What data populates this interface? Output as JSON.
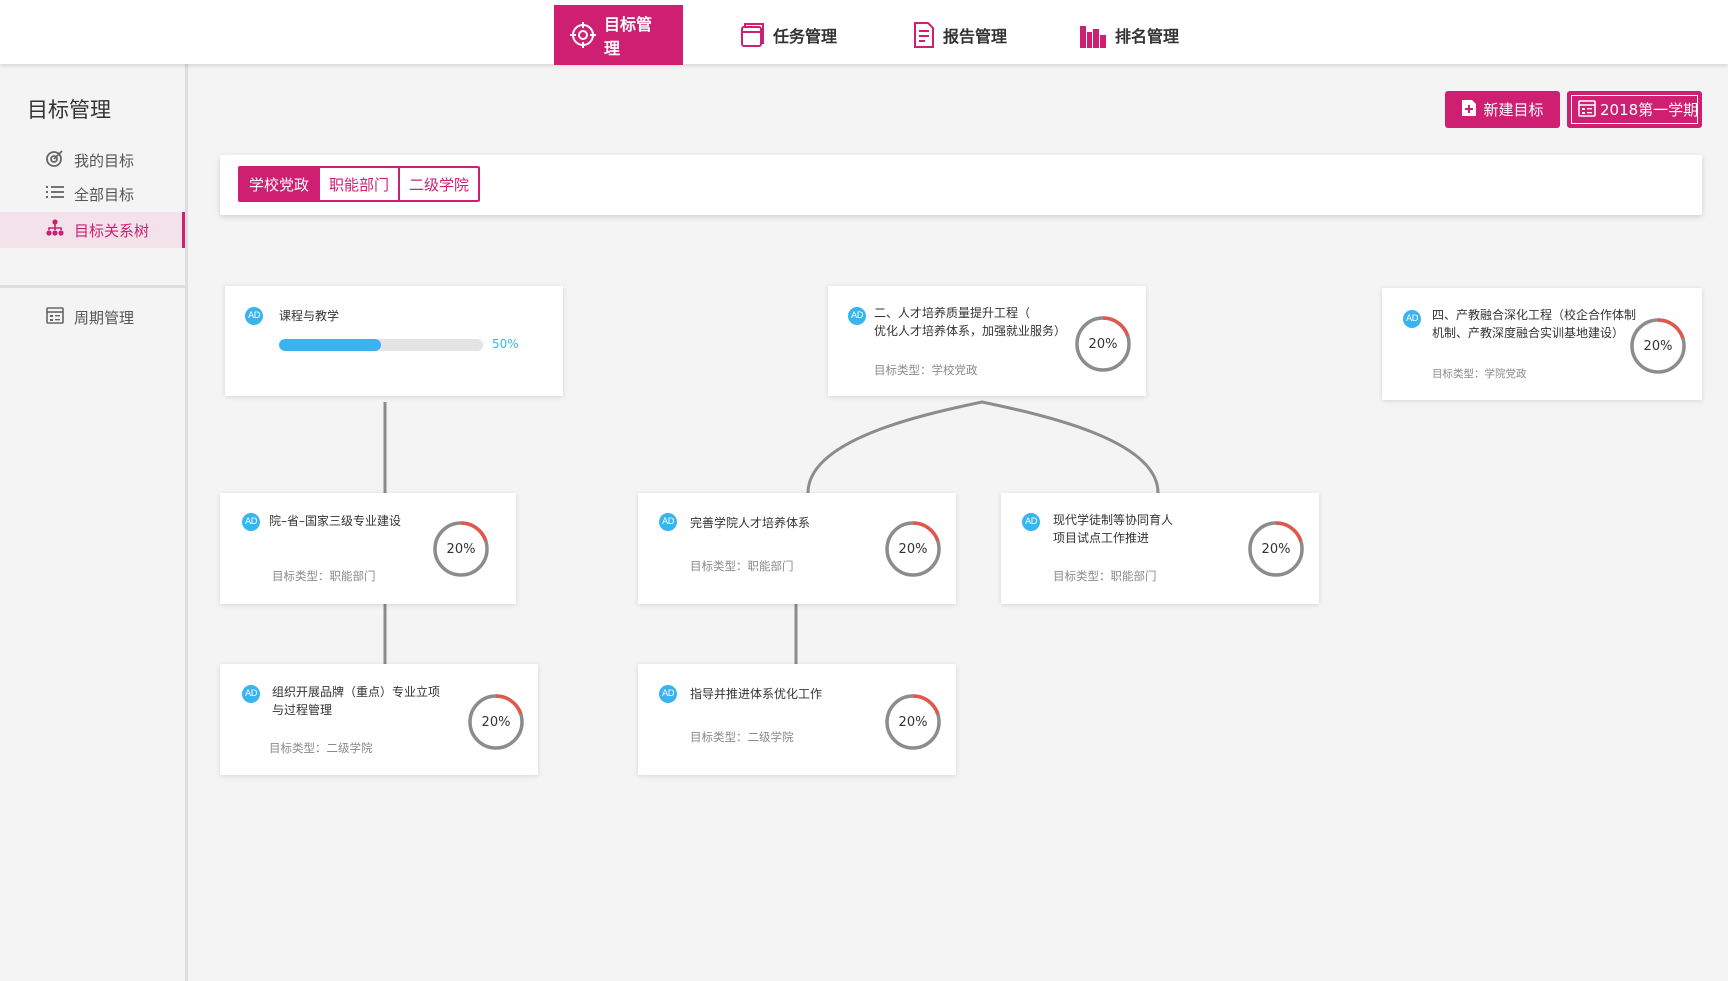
{
  "nav": {
    "items": [
      {
        "label": "目标管理",
        "icon": "target-icon",
        "active": true
      },
      {
        "label": "任务管理",
        "icon": "tasks-icon",
        "active": false
      },
      {
        "label": "报告管理",
        "icon": "report-icon",
        "active": false
      },
      {
        "label": "排名管理",
        "icon": "ranking-icon",
        "active": false
      }
    ]
  },
  "sidebar": {
    "title": "目标管理",
    "items": [
      {
        "label": "我的目标",
        "icon": "target-dart-icon"
      },
      {
        "label": "全部目标",
        "icon": "list-icon"
      },
      {
        "label": "目标关系树",
        "icon": "tree-icon",
        "active": true
      },
      {
        "label": "周期管理",
        "icon": "calendar-icon"
      }
    ]
  },
  "actions": {
    "new_goal": "新建目标",
    "term": "2018第一学期"
  },
  "filter": {
    "tabs": [
      {
        "label": "学校党政",
        "active": true
      },
      {
        "label": "职能部门",
        "active": false
      },
      {
        "label": "二级学院",
        "active": false
      }
    ]
  },
  "colors": {
    "accent": "#cf1f72",
    "progress": "#39b3f1",
    "badge": "#3ab4ee",
    "ring_track": "#8c8c8c",
    "ring_progress": "#e2574c"
  },
  "cards": [
    {
      "badge": "AD",
      "title_lines": [
        "课程与教学"
      ],
      "progress_label": "50%",
      "progress": 0.5
    },
    {
      "badge": "AD",
      "title_lines": [
        "二、人才培养质量提升工程（",
        "优化人才培养体系，加强就业服务）"
      ],
      "type_label": "目标类型：学校党政",
      "percent_label": "20%",
      "percent": 0.2
    },
    {
      "badge": "AD",
      "title_lines": [
        "四、产教融合深化工程（校企合作体制",
        "机制、产教深度融合实训基地建设）"
      ],
      "type_label": "目标类型：学院党政",
      "percent_label": "20%",
      "percent": 0.2
    },
    {
      "badge": "AD",
      "title_lines": [
        "院–省–国家三级专业建设"
      ],
      "type_label": "目标类型：职能部门",
      "percent_label": "20%",
      "percent": 0.2
    },
    {
      "badge": "AD",
      "title_lines": [
        "完善学院人才培养体系"
      ],
      "type_label": "目标类型：职能部门",
      "percent_label": "20%",
      "percent": 0.2
    },
    {
      "badge": "AD",
      "title_lines": [
        "现代学徒制等协同育人",
        "项目试点工作推进"
      ],
      "type_label": "目标类型：职能部门",
      "percent_label": "20%",
      "percent": 0.2
    },
    {
      "badge": "AD",
      "title_lines": [
        "组织开展品牌（重点）专业立项",
        "与过程管理"
      ],
      "type_label": "目标类型：二级学院",
      "percent_label": "20%",
      "percent": 0.2
    },
    {
      "badge": "AD",
      "title_lines": [
        "指导并推进体系优化工作"
      ],
      "type_label": "目标类型：二级学院",
      "percent_label": "20%",
      "percent": 0.2
    }
  ]
}
